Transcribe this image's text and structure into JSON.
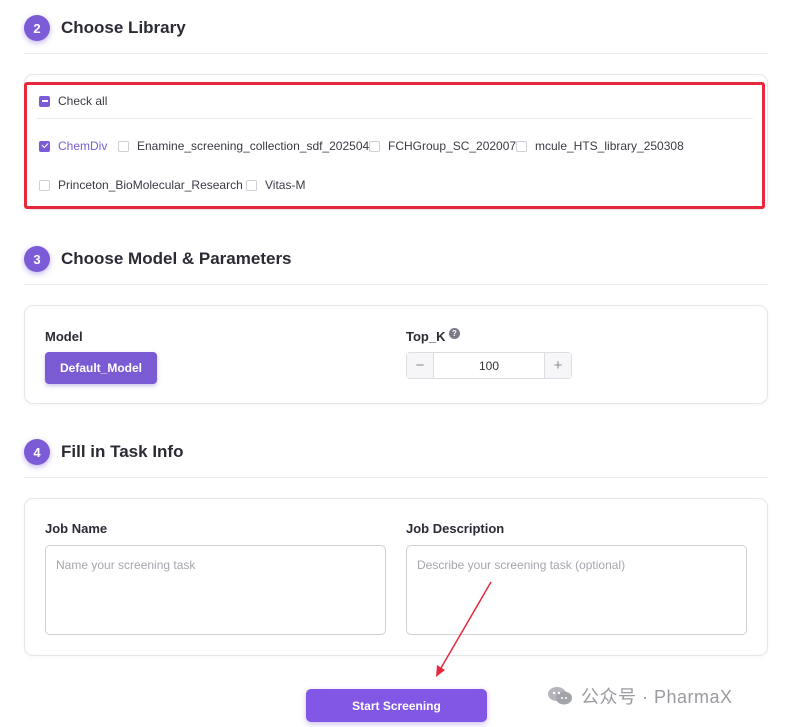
{
  "steps": {
    "library": {
      "num": "2",
      "title": "Choose Library"
    },
    "model": {
      "num": "3",
      "title": "Choose Model & Parameters"
    },
    "task": {
      "num": "4",
      "title": "Fill in Task Info"
    }
  },
  "library": {
    "check_all": "Check all",
    "items": [
      {
        "label": "ChemDiv",
        "checked": true
      },
      {
        "label": "Enamine_screening_collection_sdf_202504",
        "checked": false
      },
      {
        "label": "FCHGroup_SC_202007",
        "checked": false
      },
      {
        "label": "mcule_HTS_library_250308",
        "checked": false
      },
      {
        "label": "Princeton_BioMolecular_Research",
        "checked": false
      },
      {
        "label": "Vitas-M",
        "checked": false
      }
    ]
  },
  "model": {
    "label": "Model",
    "button": "Default_Model",
    "topk_label": "Top_K",
    "topk_help": "?",
    "topk_value": "100",
    "minus": "−",
    "plus": "+"
  },
  "task": {
    "job_name_label": "Job Name",
    "job_name_placeholder": "Name your screening task",
    "job_desc_label": "Job Description",
    "job_desc_placeholder": "Describe your screening task (optional)"
  },
  "start_button": "Start Screening",
  "watermark": "公众号 · PharmaX",
  "colors": {
    "accent": "#7b5cd6",
    "highlight": "#e8283c"
  }
}
